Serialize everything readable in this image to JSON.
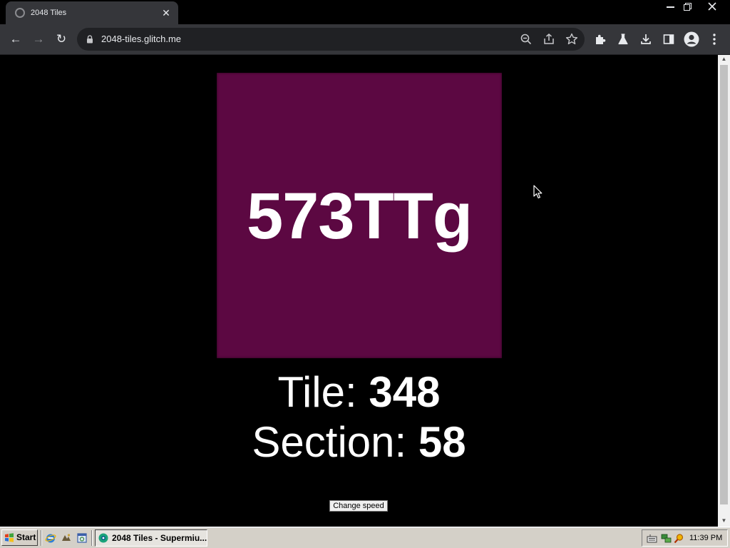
{
  "browser": {
    "tab_title": "2048 Tiles",
    "tab_close": "✕",
    "url": "2048-tiles.glitch.me",
    "nav": {
      "back": "←",
      "forward": "→",
      "reload": "↻"
    }
  },
  "page": {
    "tile": {
      "value_text": "573TTg",
      "background_color": "#5c0842",
      "text_color": "#ffffff"
    },
    "tile_label": "Tile: ",
    "tile_number": "348",
    "section_label": "Section: ",
    "section_number": "58",
    "change_speed_label": "Change speed"
  },
  "taskbar": {
    "start_label": "Start",
    "task_label": "2048 Tiles - Supermiu...",
    "clock": "11:39 PM"
  },
  "colors": {
    "page_background": "#000000",
    "chrome_toolbar": "#35363a",
    "omnibox": "#202124",
    "taskbar": "#d4d0c8"
  }
}
